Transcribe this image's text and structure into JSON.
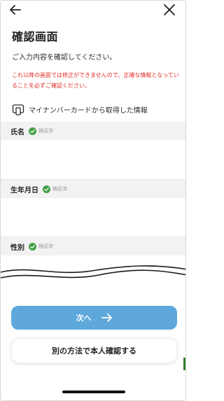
{
  "header": {
    "back_icon": "arrow-left-icon",
    "close_icon": "close-icon"
  },
  "page": {
    "title": "確認画面",
    "subtitle": "ご入力内容を確認してください。",
    "warning": "これ以降の画面では修正ができませんので、正確な情報となっていることを必ずご確認ください。",
    "warning_color": "#e0302b"
  },
  "source": {
    "icon": "card-reader-icon",
    "label": "マイナンバーカードから取得した情報"
  },
  "fields": [
    {
      "label": "氏名",
      "status": "検証済"
    },
    {
      "label": "生年月日",
      "status": "検証済"
    },
    {
      "label": "性別",
      "status": "検証済"
    }
  ],
  "actions": {
    "next_label": "次へ",
    "next_color": "#5ea8dc",
    "alt_label": "別の方法で本人確認する"
  },
  "colors": {
    "verified_green": "#43a047",
    "field_header_bg": "#f2f2f2"
  }
}
